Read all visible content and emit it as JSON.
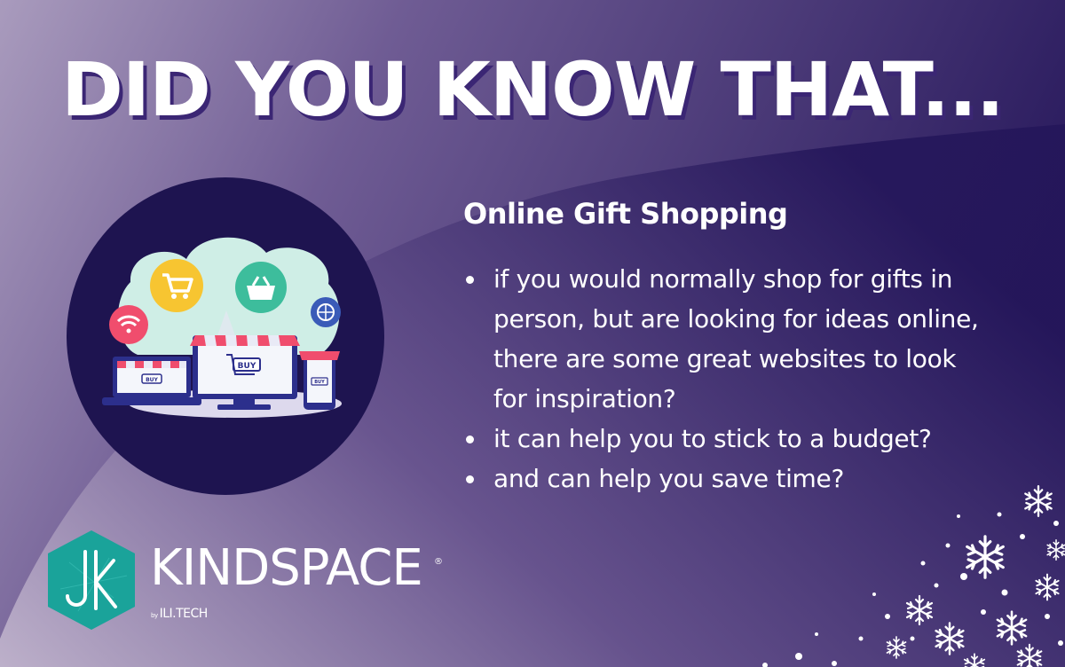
{
  "headline": "DID YOU KNOW THAT...",
  "content": {
    "title": "Online Gift Shopping",
    "bullets": [
      "if you would normally shop for gifts in person, but are looking for ideas online, there are some great websites to look for inspiration?",
      "it can help you to stick to a budget?",
      "and can help you save time?"
    ]
  },
  "illustration": {
    "buy_label": "BUY",
    "icons": [
      "wifi-icon",
      "cart-icon",
      "basket-icon",
      "globe-icon"
    ]
  },
  "logo": {
    "name": "KINDSPACE",
    "registered": "®",
    "by": "by",
    "maker": "ILI.TECH"
  },
  "colors": {
    "background_light": "#b6a6c6",
    "background_dark": "#26185a",
    "circle": "#1e1450",
    "logo_teal": "#1aa39a",
    "pink": "#f04d6d",
    "yellow": "#f7c531",
    "green": "#3dbd9c",
    "blue": "#3a5bb8"
  }
}
